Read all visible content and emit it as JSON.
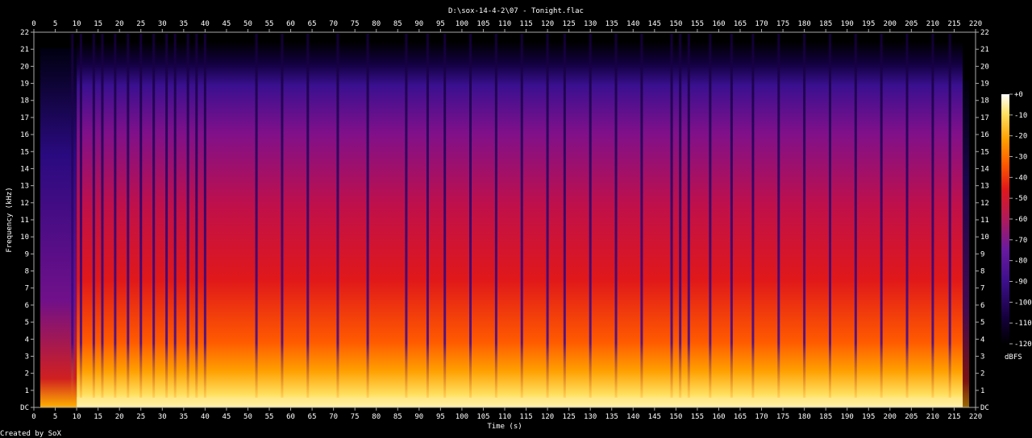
{
  "window": {
    "footer": "Created by SoX"
  },
  "chart_data": {
    "type": "heatmap",
    "title": "D:\\sox-14-4-2\\07 - Tonight.flac",
    "xlabel": "Time (s)",
    "ylabel": "Frequency (kHz)",
    "xlim": [
      0,
      220
    ],
    "ylim": [
      0,
      22
    ],
    "x_ticks": [
      "0",
      "5",
      "10",
      "15",
      "20",
      "25",
      "30",
      "35",
      "40",
      "45",
      "50",
      "55",
      "60",
      "65",
      "70",
      "75",
      "80",
      "85",
      "90",
      "95",
      "100",
      "105",
      "110",
      "115",
      "120",
      "125",
      "130",
      "135",
      "140",
      "145",
      "150",
      "155",
      "160",
      "165",
      "170",
      "175",
      "180",
      "185",
      "190",
      "195",
      "200",
      "205",
      "210",
      "215",
      "220"
    ],
    "y_ticks": [
      "DC",
      "1",
      "2",
      "3",
      "4",
      "5",
      "6",
      "7",
      "8",
      "9",
      "10",
      "11",
      "12",
      "13",
      "14",
      "15",
      "16",
      "17",
      "18",
      "19",
      "20",
      "21",
      "22"
    ],
    "colorbar": {
      "label": "dBFS",
      "range": [
        -120,
        0
      ],
      "ticks": [
        "+0",
        "-10",
        "-20",
        "-30",
        "-40",
        "-50",
        "-60",
        "-70",
        "-80",
        "-90",
        "-100",
        "-110",
        "-120"
      ],
      "colors": [
        "#000000",
        "#1a0048",
        "#3d0f8c",
        "#6a1aa0",
        "#8c1a8a",
        "#b01a5a",
        "#d01a2a",
        "#f03010",
        "#ff6a00",
        "#ffa000",
        "#ffd030",
        "#fff2a0",
        "#ffffff"
      ]
    },
    "audio_end_s": 217,
    "quiet_gaps_s": [
      9,
      11,
      14,
      16,
      19,
      22,
      25,
      28,
      31,
      33,
      36,
      38,
      40,
      52,
      58,
      64,
      71,
      78,
      87,
      92,
      96,
      102,
      108,
      114,
      120,
      124,
      130,
      136,
      142,
      149,
      151,
      153,
      158,
      163,
      168,
      174,
      180,
      186,
      192,
      198,
      204,
      210,
      214
    ]
  }
}
